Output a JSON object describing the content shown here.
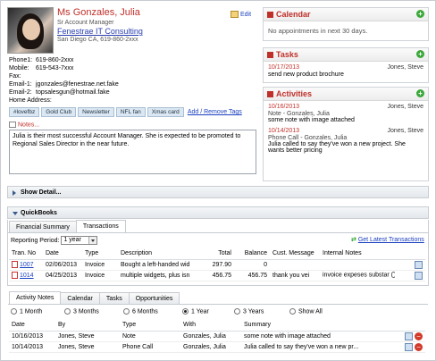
{
  "contact": {
    "name": "Ms Gonzales, Julia",
    "title": "Sr Account Manager",
    "company": "Fenestrae IT Consulting",
    "location": "San Diego CA, 619-860-2xxx",
    "edit_label": "Edit",
    "fields": [
      {
        "label": "Phone1:",
        "value": "619-860-2xxx"
      },
      {
        "label": "Mobile:",
        "value": "619-543-7xxx"
      },
      {
        "label": "Fax:",
        "value": ""
      },
      {
        "label": "Email-1:",
        "value": "jgonzales@fenestrae.net.fake"
      },
      {
        "label": "Email-2:",
        "value": "topsalesgun@hotmail.fake"
      }
    ],
    "home_address_label": "Home Address:",
    "tags": [
      "#lovefbz",
      "Gold Club",
      "Newsletter",
      "NFL fan",
      "Xmas card"
    ],
    "tags_link": "Add / Remove Tags",
    "notes_label": "Notes...",
    "notes_text": "Julia is their most successful Account Manager.  She is expected to be promoted to Regional Sales Director in the near future."
  },
  "calendar": {
    "title": "Calendar",
    "message": "No appointments in next 30 days."
  },
  "tasks": {
    "title": "Tasks",
    "items": [
      {
        "date": "10/17/2013",
        "owner": "Jones, Steve",
        "text": "send new product brochure"
      }
    ]
  },
  "activities": {
    "title": "Activities",
    "items": [
      {
        "date": "10/16/2013",
        "owner": "Jones, Steve",
        "sub": "Note - Gonzales, Julia",
        "text": "some note with image attached"
      },
      {
        "date": "10/14/2013",
        "owner": "Jones, Steve",
        "sub": "Phone Call - Gonzales, Julia",
        "text": "Julia called to say they've won a new project. She wants better pricing"
      }
    ]
  },
  "show_detail": "Show Detail...",
  "quickbooks": {
    "title": "QuickBooks",
    "tabs": [
      "Financial Summary",
      "Transactions"
    ],
    "active_tab": "Transactions",
    "period_label": "Reporting Period:",
    "period_value": "1 year",
    "get_latest": "Get Latest Transactions",
    "columns": [
      "Tran. No",
      "Date",
      "Type",
      "Description",
      "Total",
      "Balance",
      "Cust. Message",
      "Internal Notes"
    ],
    "rows": [
      {
        "no": "1007",
        "date": "02/06/2013",
        "type": "Invoice",
        "desc": "Bought a left-handed wid",
        "total": "297.90",
        "balance": "0",
        "message": "",
        "notes": ""
      },
      {
        "no": "1014",
        "date": "04/25/2013",
        "type": "Invoice",
        "desc": "multiple widgets, plus isn",
        "total": "456.75",
        "balance": "456.75",
        "message": "thank you vei",
        "notes": "invoice expeses substar"
      }
    ]
  },
  "bottom": {
    "tabs": [
      "Activity Notes",
      "Calendar",
      "Tasks",
      "Opportunities"
    ],
    "active_tab": "Activity Notes",
    "ranges": [
      "1 Month",
      "3 Months",
      "6 Months",
      "1 Year",
      "3 Years",
      "Show All"
    ],
    "selected_range": "1 Year",
    "columns": [
      "Date",
      "By",
      "Type",
      "With",
      "Summary"
    ],
    "rows": [
      {
        "date": "10/16/2013",
        "by": "Jones, Steve",
        "type": "Note",
        "with": "Gonzales, Julia",
        "summary": "some note with image attached"
      },
      {
        "date": "10/14/2013",
        "by": "Jones, Steve",
        "type": "Phone Call",
        "with": "Gonzales, Julia",
        "summary": "Julia called to say they've won a new pr..."
      }
    ]
  },
  "colors": {
    "accent_red": "#c0302a",
    "link_blue": "#1a3fbf",
    "plus_green": "#3aa83a"
  }
}
